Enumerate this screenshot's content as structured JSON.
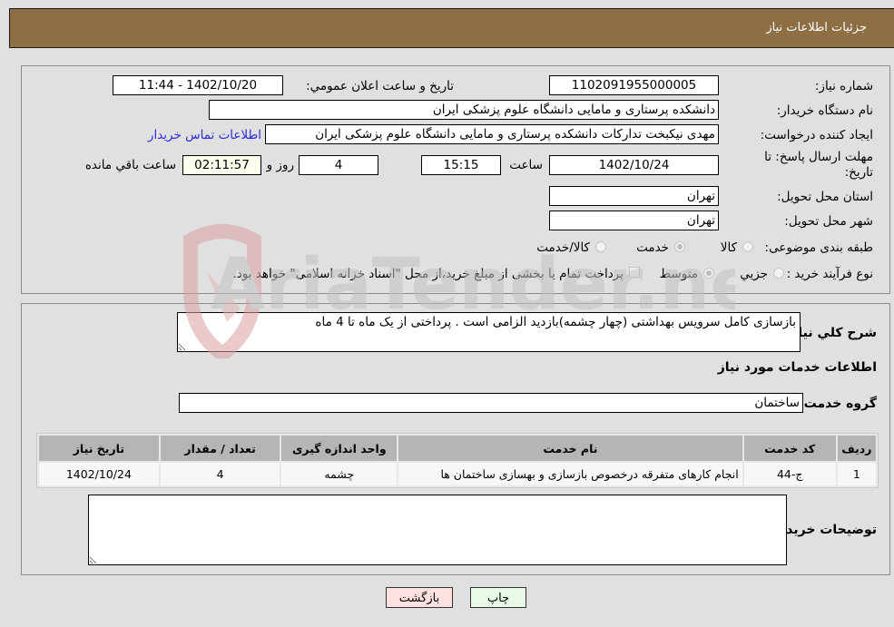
{
  "header": {
    "title": "جزئیات اطلاعات نیاز"
  },
  "form": {
    "need_number_label": "شماره نیاز:",
    "need_number": "1102091955000005",
    "announce_label": "تاریخ و ساعت اعلان عمومي:",
    "announce_value": "1402/10/20 - 11:44",
    "buyer_org_label": "نام دستگاه خریدار:",
    "buyer_org": "دانشکده پرستاری و مامایی دانشگاه علوم پزشکی ایران",
    "creator_label": "ایجاد کننده درخواست:",
    "creator": "مهدی نیکبخت تدارکات  دانشکده پرستاری و مامایی دانشگاه علوم پزشکی ایران",
    "contact_link": "اطلاعات تماس خریدار",
    "deadline_label": "مهلت ارسال پاسخ: تا تاریخ:",
    "deadline_date": "1402/10/24",
    "time_label": "ساعت",
    "deadline_time": "15:15",
    "days_value": "4",
    "days_label": "روز و",
    "remaining_time": "02:11:57",
    "remaining_label": "ساعت باقي مانده",
    "province_label": "استان محل تحویل:",
    "province": "تهران",
    "city_label": "شهر محل تحویل:",
    "city": "تهران",
    "category_label": "طبقه بندی موضوعی:",
    "category_options": [
      {
        "label": "کالا",
        "checked": false
      },
      {
        "label": "خدمت",
        "checked": true
      },
      {
        "label": "کالا/خدمت",
        "checked": false
      }
    ],
    "purchase_type_label": "نوع فرآیند خرید :",
    "purchase_type_options": [
      {
        "label": "جزیي",
        "checked": false
      },
      {
        "label": "متوسط",
        "checked": true
      }
    ],
    "treasury_checkbox_label": "پرداخت تمام یا بخشی از مبلغ خرید،از محل \"اسناد خزانه اسلامی\" خواهد بود."
  },
  "details": {
    "description_label": "شرح کلي نیاز:",
    "description": "بازسازی کامل سرویس بهداشتی (چهار چشمه)بازدید الزامی است . پرداختی از یک ماه تا 4 ماه",
    "services_heading": "اطلاعات خدمات مورد نیاز",
    "service_group_label": "گروه خدمت:",
    "service_group": "ساختمان",
    "table": {
      "headers": [
        "ردیف",
        "کد خدمت",
        "نام خدمت",
        "واحد اندازه گیری",
        "تعداد / مقدار",
        "تاریخ نیاز"
      ],
      "rows": [
        [
          "1",
          "ج-44",
          "انجام کارهای متفرقه درخصوص بازسازی و بهسازی ساختمان ها",
          "چشمه",
          "4",
          "1402/10/24"
        ]
      ]
    },
    "buyer_notes_label": "توضیحات خریدار:",
    "buyer_notes": ""
  },
  "buttons": {
    "print": "چاپ",
    "back": "بازگشت"
  },
  "watermark": {
    "text": "AriaTender.neT"
  }
}
